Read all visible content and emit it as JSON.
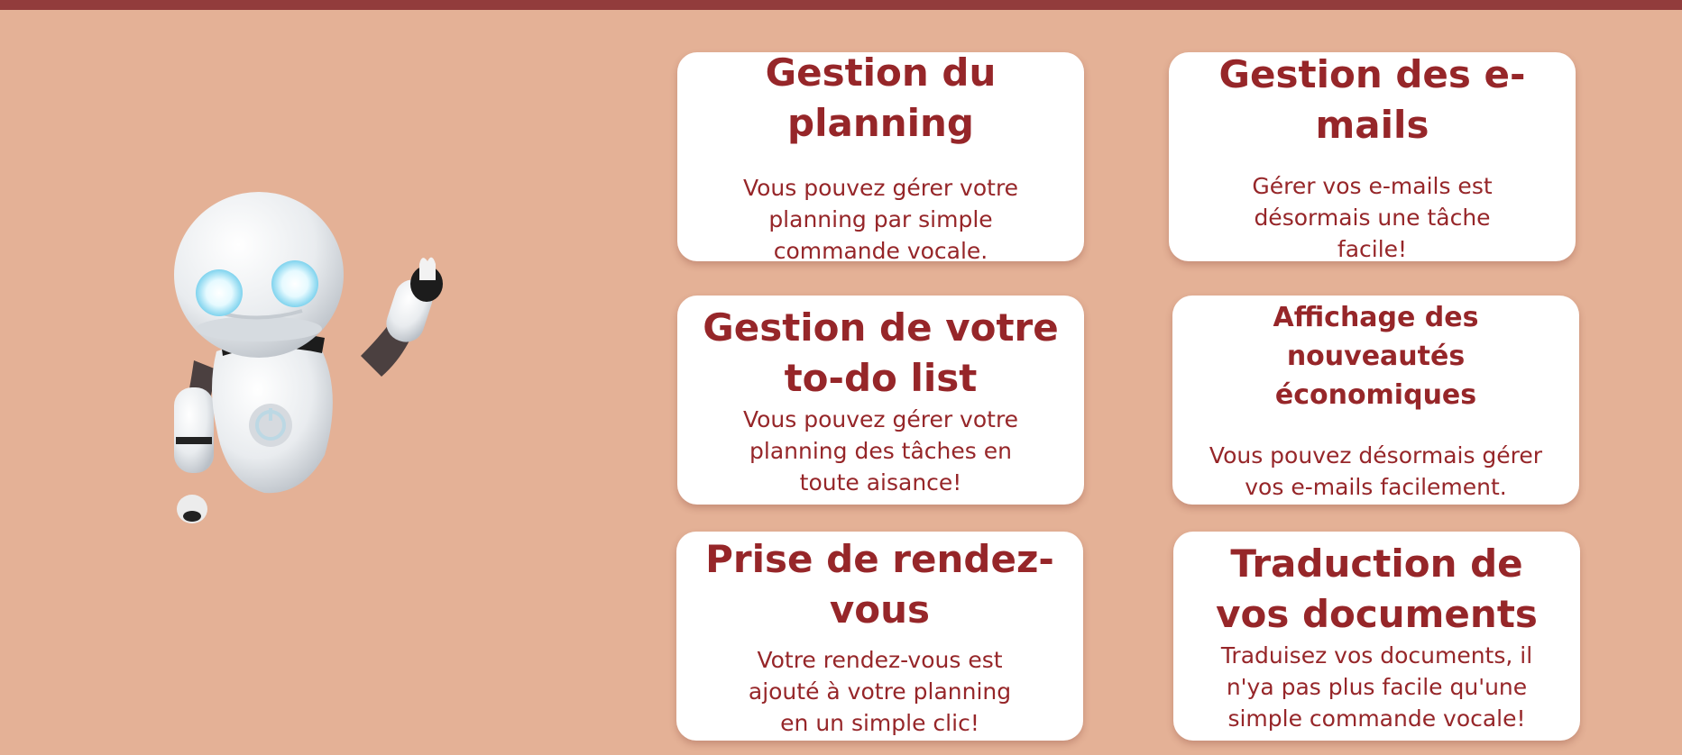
{
  "colors": {
    "background": "#e4b196",
    "topbar": "#923c3c",
    "card_background": "#ffffff",
    "card_text": "#962629"
  },
  "hero": {
    "illustration": "waving-robot-icon"
  },
  "features": [
    {
      "title": "Gestion du planning",
      "text": "Vous pouvez gérer votre planning par simple commande vocale."
    },
    {
      "title": "Gestion des e-mails",
      "text": "Gérer vos e-mails est désormais une tâche facile!"
    },
    {
      "title": "Gestion de votre to-do list",
      "text": "Vous pouvez gérer votre planning des tâches en toute aisance!"
    },
    {
      "title": "Affichage des nouveautés économiques",
      "text": "Vous pouvez désormais gérer vos e-mails facilement."
    },
    {
      "title": "Prise de rendez-vous",
      "text": "Votre rendez-vous est ajouté à votre planning en un simple clic!"
    },
    {
      "title": "Traduction de vos documents",
      "text": "Traduisez vos documents, il n'ya pas plus facile qu'une simple commande vocale!"
    }
  ]
}
